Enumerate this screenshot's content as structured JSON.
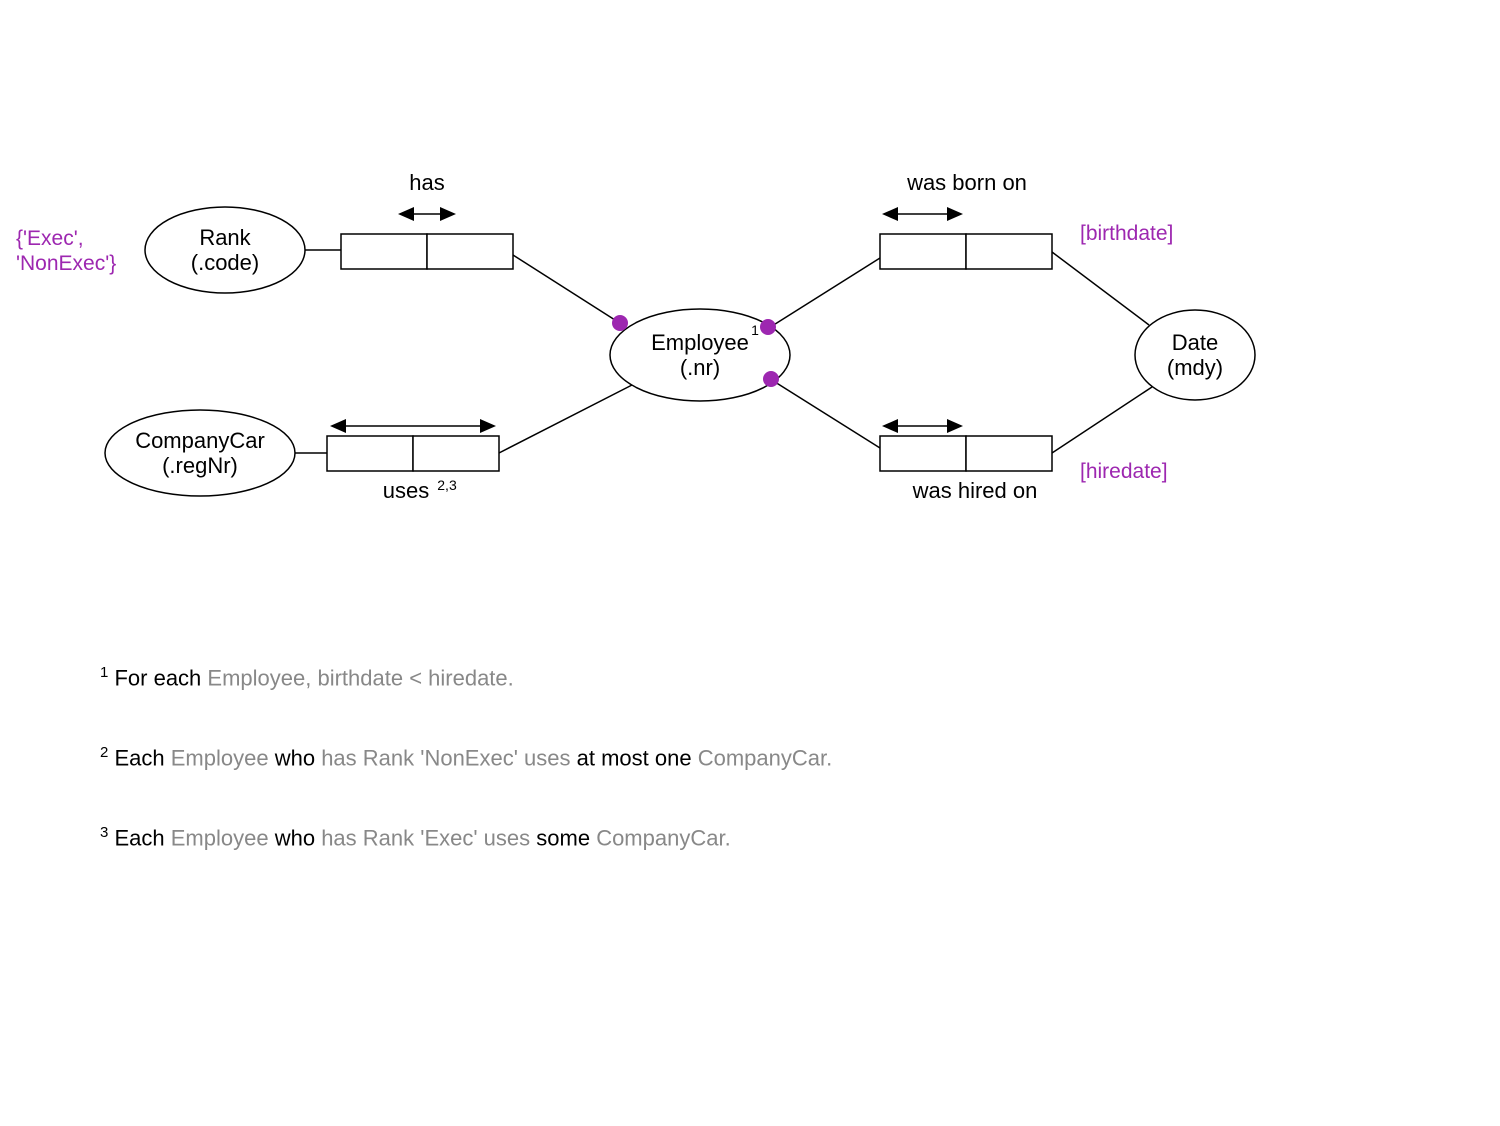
{
  "entities": {
    "rank": {
      "line1": "Rank",
      "line2": "(.code)"
    },
    "companycar": {
      "line1": "CompanyCar",
      "line2": "(.regNr)"
    },
    "employee": {
      "line1": "Employee",
      "line2": "(.nr)",
      "sup": "1"
    },
    "date": {
      "line1": "Date",
      "line2": "(mdy)"
    }
  },
  "predicates": {
    "has": {
      "label": "has"
    },
    "uses": {
      "label": "uses",
      "sup": "2,3"
    },
    "born": {
      "label": "was born on"
    },
    "hired": {
      "label": "was hired on"
    }
  },
  "value_constraint": {
    "line1": "{'Exec',",
    "line2": "'NonExec'}"
  },
  "role_names": {
    "birthdate": "[birthdate]",
    "hiredate": "[hiredate]"
  },
  "footnotes": {
    "f1": {
      "sup": "1",
      "plain1": "  For each ",
      "gray1": "Employee, birthdate < hiredate."
    },
    "f2": {
      "sup": "2",
      "plain1": "  Each ",
      "gray1": "Employee",
      "plain2": " who ",
      "gray2": "has Rank 'NonExec' uses",
      "plain3": " at most one ",
      "gray3": "CompanyCar."
    },
    "f3": {
      "sup": "3",
      "plain1": "  Each ",
      "gray1": "Employee",
      "plain2": " who ",
      "gray2": "has Rank 'Exec' uses",
      "plain3": " some ",
      "gray3": "CompanyCar."
    }
  }
}
